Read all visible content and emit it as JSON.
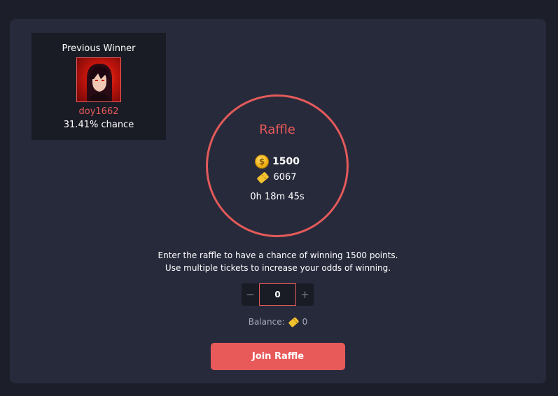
{
  "previous_winner": {
    "title": "Previous Winner",
    "name": "doy1662",
    "chance": "31.41% chance"
  },
  "raffle": {
    "title": "Raffle",
    "prize_points": "1500",
    "tickets_total": "6067",
    "time_remaining": "0h 18m 45s"
  },
  "description": "Enter the raffle to have a chance of winning 1500 points. Use multiple tickets to increase your odds of winning.",
  "stepper": {
    "decrement_label": "−",
    "value": "0",
    "increment_label": "+"
  },
  "balance": {
    "label": "Balance:",
    "value": "0"
  },
  "join_button": {
    "label": "Join Raffle"
  },
  "icons": {
    "coin_glyph": "$",
    "coin_color": "#f2b51a",
    "ticket_color": "#f2c12e"
  },
  "colors": {
    "accent": "#e85a5a",
    "panel_bg": "#272a3b",
    "page_bg": "#1c1f29",
    "card_bg": "#1a1c25"
  }
}
